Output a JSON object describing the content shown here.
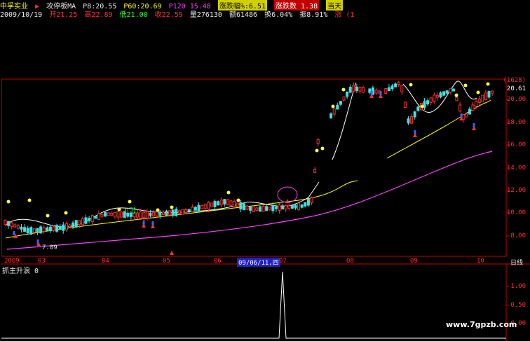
{
  "header": {
    "stock_name": "中孚实业",
    "indicator_name": "攻停板MA",
    "ma_p8": "P8:20.55",
    "ma_p60": "P60:20.69",
    "ma_p120": "P120 15.48",
    "change_pct_label": "涨跌幅%:6.51",
    "change_count_label": "涨跌数 1.38",
    "today_label": "当天"
  },
  "quote": {
    "date": "2009/10/19",
    "open": "开21.25",
    "high": "高22.89",
    "low": "低21.00",
    "close": "收22.59",
    "volume": "量276130",
    "amount": "额61486",
    "turnover": "换6.04%",
    "amplitude": "振8.91%",
    "rise": "涨 (1"
  },
  "chart_data": [
    {
      "type": "candlestick",
      "y_ticks": [
        "20.00",
        "18.00",
        "16.00",
        "14.00",
        "12.00",
        "10.00",
        "8.00"
      ],
      "top_labels": [
        "(1628)",
        "20.61"
      ],
      "x_ticks": [
        "2009",
        "03",
        "04",
        "05",
        "06",
        "09/06/11,四",
        "07",
        "08",
        "09",
        "10"
      ],
      "period_label": "日线",
      "annotation_low": "7.09",
      "colors": {
        "up": "#ff3030",
        "down": "#40e0e0",
        "ma_short": "#ffffff",
        "ma_mid": "#ffff00",
        "ma_long": "#ff40ff"
      }
    },
    {
      "type": "line",
      "title": "抓主升浪 0",
      "y_ticks": [
        "1.00",
        "0.50",
        "0.00"
      ]
    }
  ],
  "watermark": "www.7gpzb.com"
}
